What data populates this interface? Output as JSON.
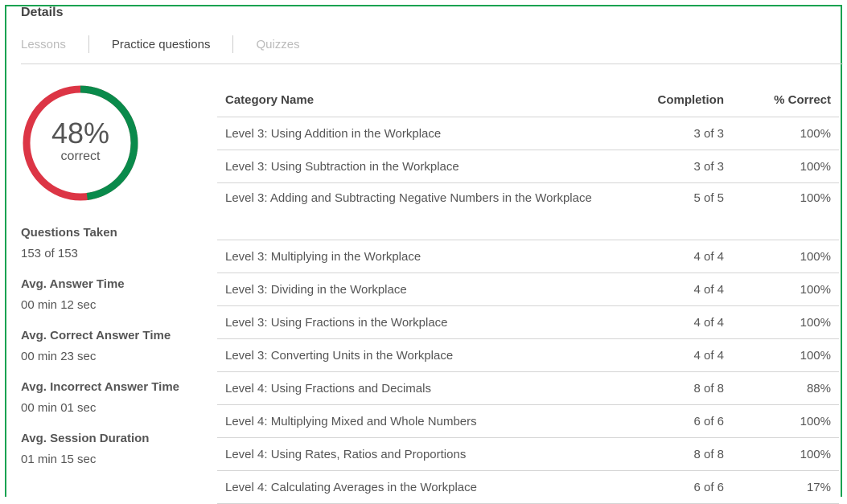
{
  "header": {
    "title": "Details"
  },
  "tabs": [
    {
      "label": "Lessons",
      "active": false
    },
    {
      "label": "Practice questions",
      "active": true
    },
    {
      "label": "Quizzes",
      "active": false
    }
  ],
  "score": {
    "percent_text": "48%",
    "label": "correct",
    "fraction": 0.48,
    "colors": {
      "correct": "#0a8a4b",
      "incorrect": "#dc3545"
    }
  },
  "stats": [
    {
      "label": "Questions Taken",
      "value": "153 of 153"
    },
    {
      "label": "Avg. Answer Time",
      "value": "00 min 12 sec"
    },
    {
      "label": "Avg. Correct Answer Time",
      "value": "00 min 23 sec"
    },
    {
      "label": "Avg. Incorrect Answer Time",
      "value": "00 min 01 sec"
    },
    {
      "label": "Avg. Session Duration",
      "value": "01 min 15 sec"
    }
  ],
  "table": {
    "columns": [
      "Category Name",
      "Completion",
      "% Correct"
    ],
    "rows": [
      {
        "name": "Level 3: Using Addition in the Workplace",
        "completion": "3 of 3",
        "correct": "100%"
      },
      {
        "name": "Level 3: Using Subtraction in the Workplace",
        "completion": "3 of 3",
        "correct": "100%"
      },
      {
        "name": "Level 3: Adding and Subtracting Negative Numbers in the Workplace",
        "completion": "5 of 5",
        "correct": "100%"
      },
      {
        "name": "Level 3: Multiplying in the Workplace",
        "completion": "4 of 4",
        "correct": "100%"
      },
      {
        "name": "Level 3: Dividing in the Workplace",
        "completion": "4 of 4",
        "correct": "100%"
      },
      {
        "name": "Level 3: Using Fractions in the Workplace",
        "completion": "4 of 4",
        "correct": "100%"
      },
      {
        "name": "Level 3: Converting Units in the Workplace",
        "completion": "4 of 4",
        "correct": "100%"
      },
      {
        "name": "Level 4: Using Fractions and Decimals",
        "completion": "8 of 8",
        "correct": "88%"
      },
      {
        "name": "Level 4: Multiplying Mixed and Whole Numbers",
        "completion": "6 of 6",
        "correct": "100%"
      },
      {
        "name": "Level 4: Using Rates, Ratios and Proportions",
        "completion": "8 of 8",
        "correct": "100%"
      },
      {
        "name": "Level 4: Calculating Averages in the Workplace",
        "completion": "6 of 6",
        "correct": "17%"
      }
    ]
  }
}
